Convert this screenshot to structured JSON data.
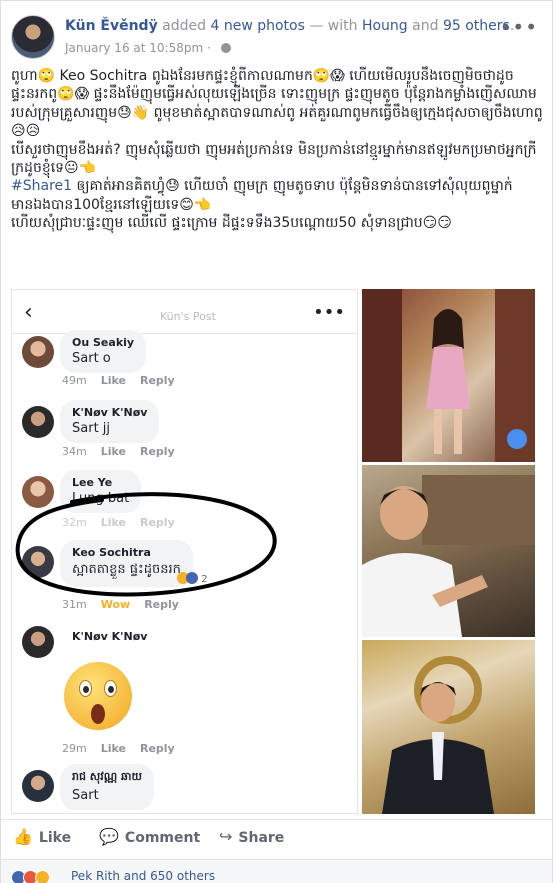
{
  "post": {
    "author": "Kün Ěvěndÿ",
    "added_text": "added",
    "photos_link": "4 new photos",
    "with_text": "— with",
    "tag1": "Houng",
    "and_text": "and",
    "tag_others": "95 others",
    "period": ".",
    "date": "January 16 at 10:58pm",
    "dot": "·",
    "body": {
      "line1": "ពូហា🙄 Keo Sochitra ពូឯងនែរមកផ្ទះខ្ញុំពីកាលណាមក🙄😱 ហើយមើលរូបនឹងចេញមិចថាដូចផ្ទះនរកពូ🙄😱 ផ្ទះនឹងម៉ែញុមធ្វើអស់លុយឡើងច្រើន ទោះញុមក្រ ផ្ទះញុមតូច ប៉ុន្តែរាងកម្លាំងញើសឈាមរបស់ក្រុមគ្រួសារញុម😓👋 ពូមុខមាត់ស្អាតបាទណាស់ពូ អត់គួរណាពូមកធ្វើចឹងឲ្យក្មេងជុសចាឲ្យចឹងហោពូ😥😥",
      "line2": "បើសួរថាញុមខឹងអត់? ញុមសុំឆ្លើយថា ញុមអត់ប្រកាន់ទេ មិនប្រកាន់នៅខ្មួរម្នាក់មានឥឡូវមកប្រមាថអ្នកក្រីក្រដូចខ្ញុំទេ😐👈",
      "hashtag": "#Share1",
      "line3": " ឲ្យគាត់អានគិតហ្វុំ😓 ហើយចាំ ញុមក្រ ញុមតូចទាប ប៉ុន្តែមិនទាន់បានទៅសុំលុយពូម្នាក់មានឯងបាន100ខ្មែរនៅឡើយទេ😊👈",
      "line4": "ហើយសុំជ្រាបៈផ្ទះញុម ឈើលើ ផ្ទះក្រោម ដីផ្ទះទទឹង35បណ្ដោយ50 សុំទានជ្រាប😏😏"
    }
  },
  "screenshot": {
    "title": "Kün's Post",
    "comments": [
      {
        "name": "Ou Seakiy",
        "text": "Sart o",
        "time": "49m",
        "like": "Like",
        "reply": "Reply"
      },
      {
        "name": "K'Nøv K'Nøv",
        "text": "Sart jj",
        "time": "34m",
        "like": "Like",
        "reply": "Reply"
      },
      {
        "name": "Lee Ye",
        "text": "Lung bat",
        "time": "32m",
        "like": "Like",
        "reply": "Reply"
      },
      {
        "name": "Keo Sochitra",
        "text": "ស្អាតតាខ្លួន ផ្ទះដូចនរក",
        "time": "31m",
        "like": "Wow",
        "reply": "Reply",
        "reaction_count": "2"
      },
      {
        "name": "K'Nøv K'Nøv",
        "text": "",
        "time": "29m",
        "like": "Like",
        "reply": "Reply"
      },
      {
        "name": "រាជ សុវណ្ណ ឆាយ",
        "text": "Sart",
        "time": "",
        "like": "",
        "reply": ""
      }
    ]
  },
  "actions": {
    "like": "Like",
    "comment": "Comment",
    "share": "Share"
  },
  "reactions": {
    "summary": "Pek Rith and 650 others"
  },
  "colors": {
    "link": "#365899",
    "meta": "#90949c",
    "wow": "#f7b125",
    "like_blue": "#4267b2"
  }
}
